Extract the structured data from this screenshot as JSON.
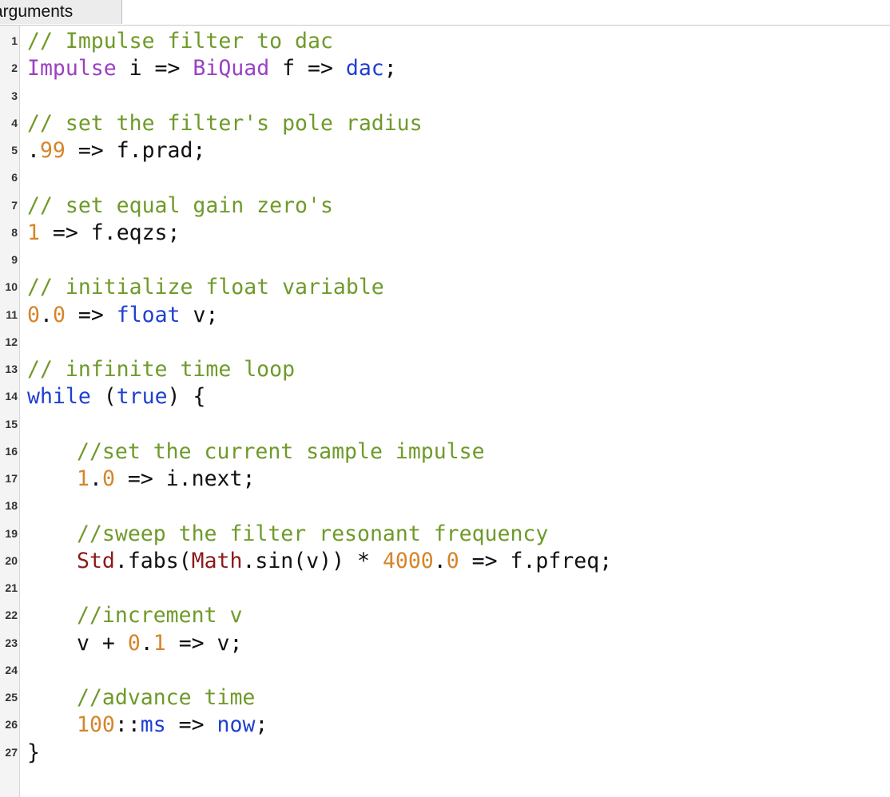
{
  "tab": {
    "label": "arguments"
  },
  "colors": {
    "comment": "#6f9a2a",
    "number": "#d6852a",
    "keyword": "#1f3fd0",
    "ugen": "#9a40c4",
    "class": "#8b1a1a",
    "text": "#111111"
  },
  "lines": [
    {
      "n": "1",
      "indent": false,
      "tokens": [
        {
          "t": "comment",
          "v": "// Impulse filter to dac"
        }
      ]
    },
    {
      "n": "2",
      "indent": false,
      "tokens": [
        {
          "t": "ugen",
          "v": "Impulse"
        },
        {
          "t": "txt",
          "v": " i => "
        },
        {
          "t": "ugen",
          "v": "BiQuad"
        },
        {
          "t": "txt",
          "v": " f => "
        },
        {
          "t": "kw",
          "v": "dac"
        },
        {
          "t": "txt",
          "v": ";"
        }
      ]
    },
    {
      "n": "3",
      "indent": false,
      "tokens": []
    },
    {
      "n": "4",
      "indent": false,
      "tokens": [
        {
          "t": "comment",
          "v": "// set the filter's pole radius"
        }
      ]
    },
    {
      "n": "5",
      "indent": false,
      "tokens": [
        {
          "t": "txt",
          "v": "."
        },
        {
          "t": "num",
          "v": "99"
        },
        {
          "t": "txt",
          "v": " => f.prad;"
        }
      ]
    },
    {
      "n": "6",
      "indent": false,
      "tokens": []
    },
    {
      "n": "7",
      "indent": false,
      "tokens": [
        {
          "t": "comment",
          "v": "// set equal gain zero's"
        }
      ]
    },
    {
      "n": "8",
      "indent": false,
      "tokens": [
        {
          "t": "num",
          "v": "1"
        },
        {
          "t": "txt",
          "v": " => f.eqzs;"
        }
      ]
    },
    {
      "n": "9",
      "indent": false,
      "tokens": []
    },
    {
      "n": "10",
      "indent": false,
      "tokens": [
        {
          "t": "comment",
          "v": "// initialize float variable"
        }
      ]
    },
    {
      "n": "11",
      "indent": false,
      "tokens": [
        {
          "t": "num",
          "v": "0"
        },
        {
          "t": "txt",
          "v": "."
        },
        {
          "t": "num",
          "v": "0"
        },
        {
          "t": "txt",
          "v": " => "
        },
        {
          "t": "kw",
          "v": "float"
        },
        {
          "t": "txt",
          "v": " v;"
        }
      ]
    },
    {
      "n": "12",
      "indent": false,
      "tokens": []
    },
    {
      "n": "13",
      "indent": false,
      "tokens": [
        {
          "t": "comment",
          "v": "// infinite time loop"
        }
      ]
    },
    {
      "n": "14",
      "indent": false,
      "tokens": [
        {
          "t": "kw",
          "v": "while"
        },
        {
          "t": "txt",
          "v": " ("
        },
        {
          "t": "kw",
          "v": "true"
        },
        {
          "t": "txt",
          "v": ") {"
        }
      ]
    },
    {
      "n": "15",
      "indent": false,
      "tokens": []
    },
    {
      "n": "16",
      "indent": true,
      "tokens": [
        {
          "t": "comment",
          "v": "//set the current sample impulse"
        }
      ]
    },
    {
      "n": "17",
      "indent": true,
      "tokens": [
        {
          "t": "num",
          "v": "1"
        },
        {
          "t": "txt",
          "v": "."
        },
        {
          "t": "num",
          "v": "0"
        },
        {
          "t": "txt",
          "v": " => i.next;"
        }
      ]
    },
    {
      "n": "18",
      "indent": false,
      "tokens": []
    },
    {
      "n": "19",
      "indent": true,
      "tokens": [
        {
          "t": "comment",
          "v": "//sweep the filter resonant frequency"
        }
      ]
    },
    {
      "n": "20",
      "indent": true,
      "tokens": [
        {
          "t": "cls",
          "v": "Std"
        },
        {
          "t": "txt",
          "v": ".fabs("
        },
        {
          "t": "cls",
          "v": "Math"
        },
        {
          "t": "txt",
          "v": ".sin(v)) * "
        },
        {
          "t": "num",
          "v": "4000"
        },
        {
          "t": "txt",
          "v": "."
        },
        {
          "t": "num",
          "v": "0"
        },
        {
          "t": "txt",
          "v": " => f.pfreq;"
        }
      ]
    },
    {
      "n": "21",
      "indent": false,
      "tokens": []
    },
    {
      "n": "22",
      "indent": true,
      "tokens": [
        {
          "t": "comment",
          "v": "//increment v"
        }
      ]
    },
    {
      "n": "23",
      "indent": true,
      "tokens": [
        {
          "t": "txt",
          "v": "v + "
        },
        {
          "t": "num",
          "v": "0"
        },
        {
          "t": "txt",
          "v": "."
        },
        {
          "t": "num",
          "v": "1"
        },
        {
          "t": "txt",
          "v": " => v;"
        }
      ]
    },
    {
      "n": "24",
      "indent": false,
      "tokens": []
    },
    {
      "n": "25",
      "indent": true,
      "tokens": [
        {
          "t": "comment",
          "v": "//advance time"
        }
      ]
    },
    {
      "n": "26",
      "indent": true,
      "tokens": [
        {
          "t": "num",
          "v": "100"
        },
        {
          "t": "txt",
          "v": "::"
        },
        {
          "t": "kw",
          "v": "ms"
        },
        {
          "t": "txt",
          "v": " => "
        },
        {
          "t": "kw",
          "v": "now"
        },
        {
          "t": "txt",
          "v": ";"
        }
      ]
    },
    {
      "n": "27",
      "indent": false,
      "tokens": [
        {
          "t": "txt",
          "v": "}"
        }
      ]
    }
  ]
}
